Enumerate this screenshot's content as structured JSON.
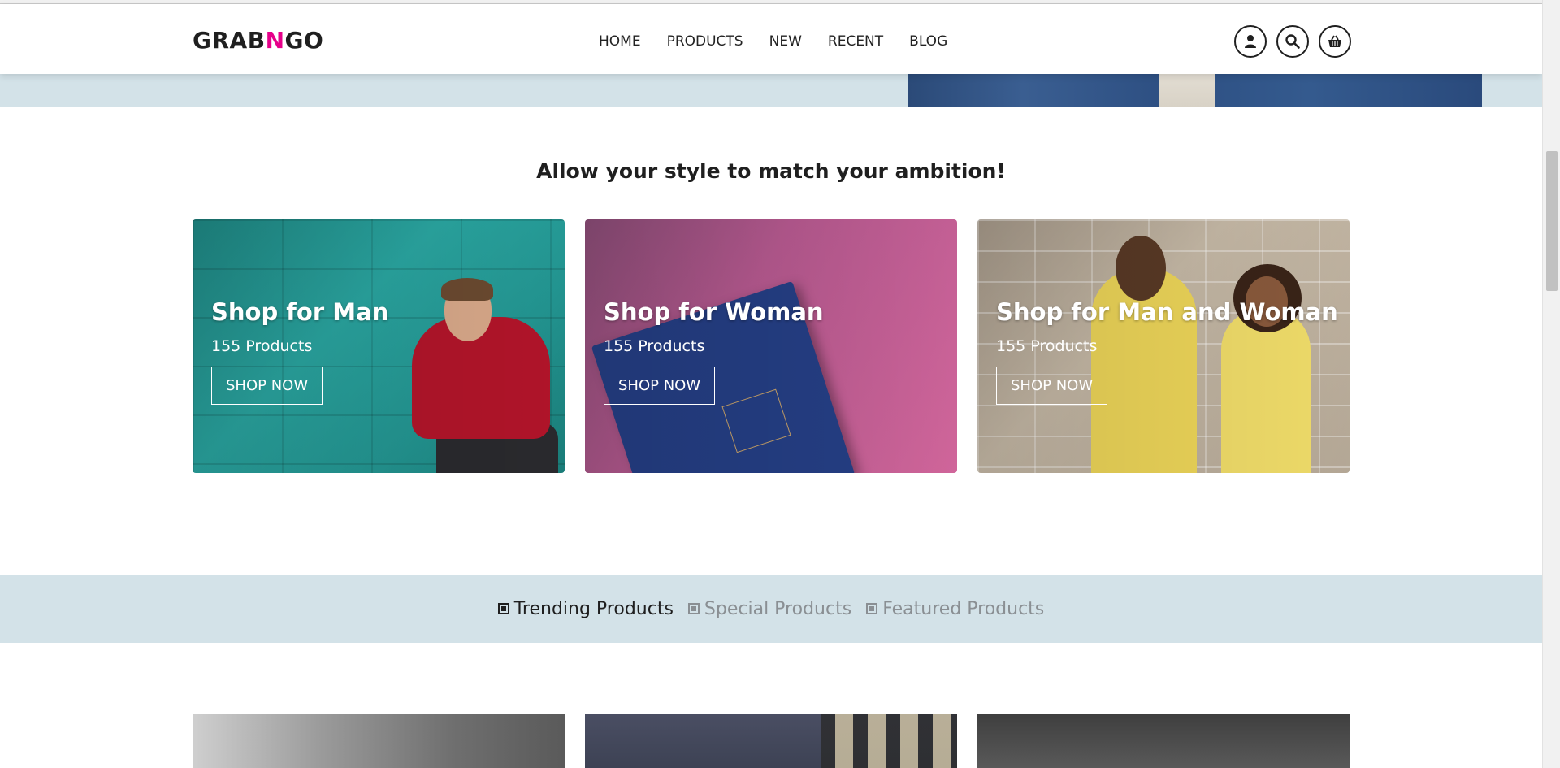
{
  "header": {
    "logo_prefix": "GRAB",
    "logo_accent": "N",
    "logo_suffix": "GO",
    "nav": [
      "HOME",
      "PRODUCTS",
      "NEW",
      "RECENT",
      "BLOG"
    ],
    "icons": [
      "user-icon",
      "search-icon",
      "basket-icon"
    ],
    "accent_color": "#e6008a"
  },
  "tagline": "Allow your style to match your ambition!",
  "categories": [
    {
      "title": "Shop for Man",
      "count": "155 Products",
      "button": "SHOP NOW"
    },
    {
      "title": "Shop for Woman",
      "count": "155 Products",
      "button": "SHOP NOW"
    },
    {
      "title": "Shop for Man and Woman",
      "count": "155 Products",
      "button": "SHOP NOW"
    }
  ],
  "tabs": [
    {
      "label": "Trending Products",
      "active": true
    },
    {
      "label": "Special Products",
      "active": false
    },
    {
      "label": "Featured Products",
      "active": false
    }
  ],
  "colors": {
    "band": "#d3e2e8",
    "text": "#1f1f1f",
    "inactive_tab": "#8a8f93"
  }
}
